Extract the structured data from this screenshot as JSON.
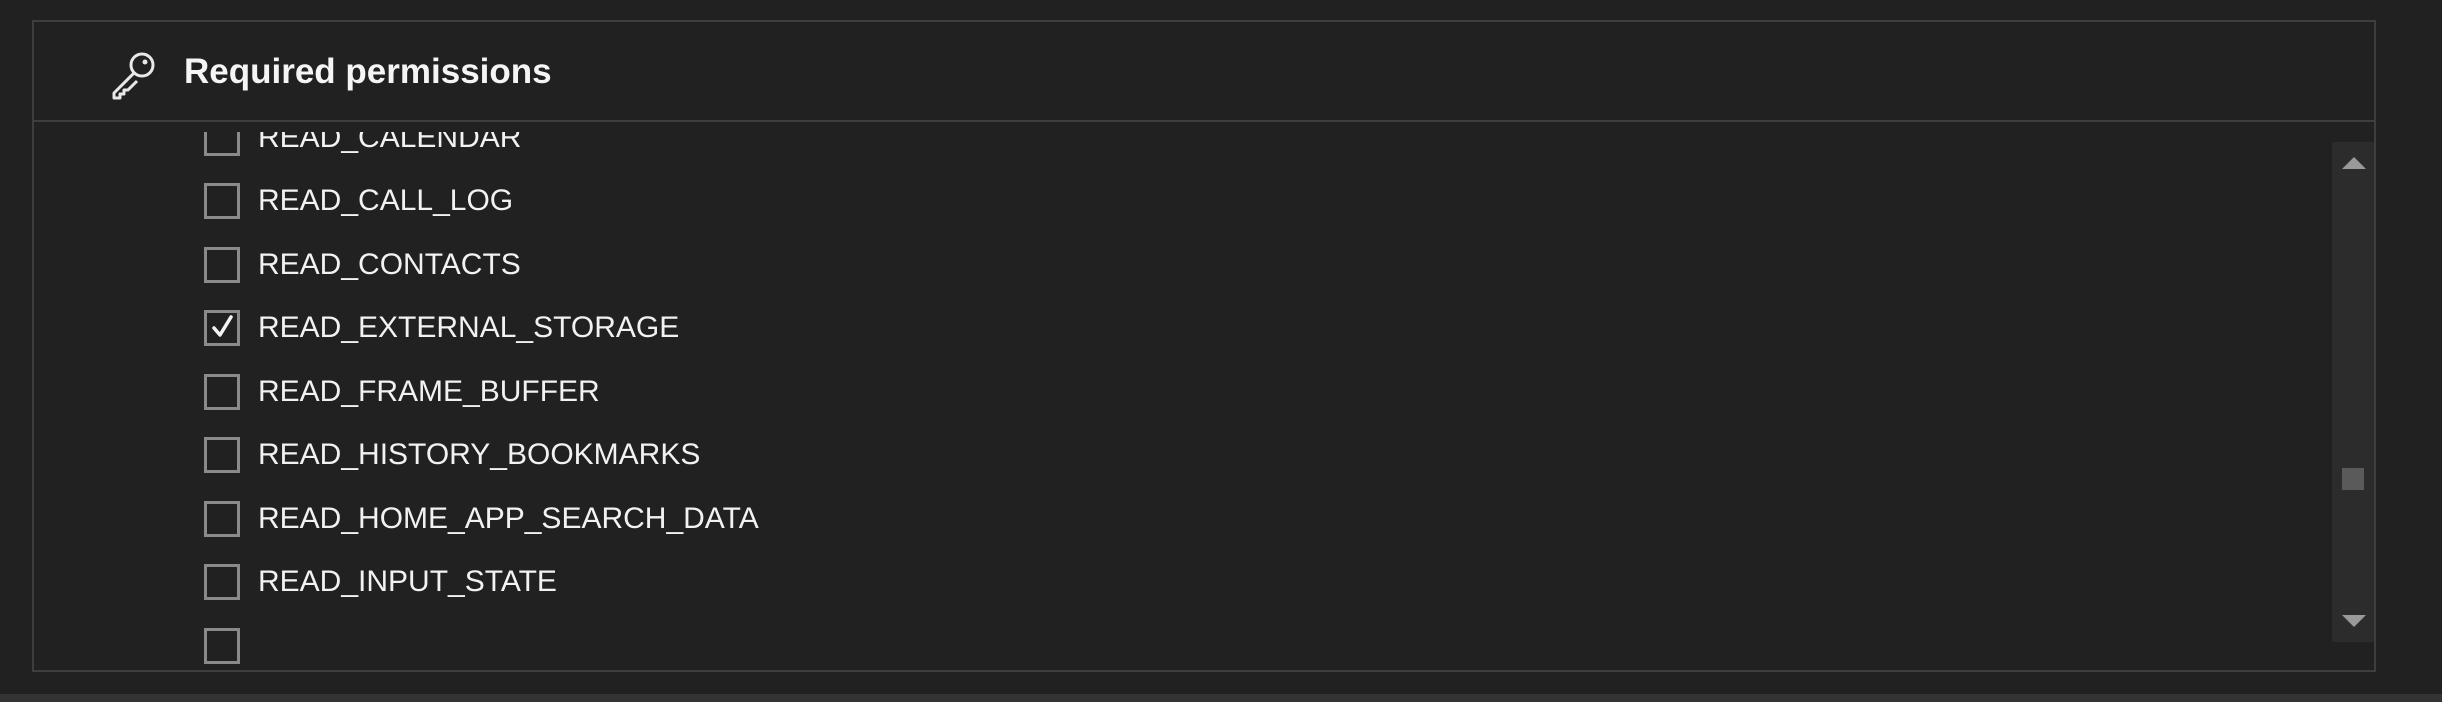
{
  "header": {
    "title": "Required permissions",
    "icon": "key-icon"
  },
  "permissions": [
    {
      "label": "READ_CALENDAR",
      "checked": false
    },
    {
      "label": "READ_CALL_LOG",
      "checked": false
    },
    {
      "label": "READ_CONTACTS",
      "checked": false
    },
    {
      "label": "READ_EXTERNAL_STORAGE",
      "checked": true
    },
    {
      "label": "READ_FRAME_BUFFER",
      "checked": false
    },
    {
      "label": "READ_HISTORY_BOOKMARKS",
      "checked": false
    },
    {
      "label": "READ_HOME_APP_SEARCH_DATA",
      "checked": false
    },
    {
      "label": "READ_INPUT_STATE",
      "checked": false
    }
  ],
  "colors": {
    "background": "#212121",
    "border": "#3e3e3e",
    "checkbox_border": "#8a8a8a",
    "text": "#f2f2f2"
  }
}
